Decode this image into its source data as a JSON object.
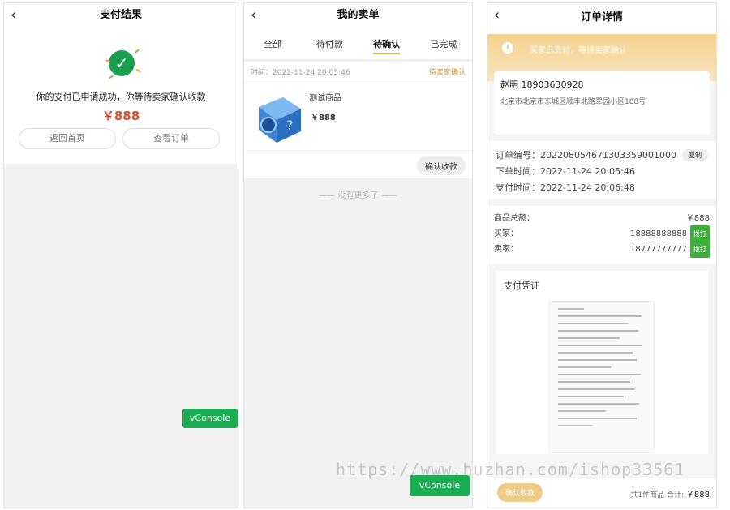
{
  "colors": {
    "accent_red": "#e0482e",
    "gold": "#e8b548",
    "green": "#1aad52"
  },
  "panel1": {
    "title": "支付结果",
    "back_icon": "‹",
    "message": "你的支付已申请成功，你等待卖家确认收款",
    "amount": "￥888",
    "btn_home": "返回首页",
    "btn_order": "查看订单",
    "vconsole": "vConsole"
  },
  "panel2": {
    "title": "我的卖单",
    "back_icon": "‹",
    "tabs": [
      "全部",
      "待付款",
      "待确认",
      "已完成"
    ],
    "order": {
      "time": "时间：2022-11-24 20:05:46",
      "status": "待卖家确认",
      "product_name": "测试商品",
      "price": "￥888",
      "confirm_btn": "确认收款"
    },
    "no_more": "—— 没有更多了 ——",
    "vconsole": "vConsole"
  },
  "panel3": {
    "title": "订单详情",
    "back_icon": "‹",
    "banner_text": "买家已支付，等待卖家确认",
    "addr_name": "赵明   18903630928",
    "addr_line": "北京市北京市东城区顺丰北路翠园小区188号",
    "order_no": "订单编号：2022080546713033590010​00",
    "order_time": "下单时间：2022-11-24 20:05:46",
    "pay_time": "支付时间：2022-11-24 20:06:48",
    "copy_btn": "复制",
    "goods_total_label": "商品总额：",
    "goods_total": "￥888",
    "buyer_label": "买家：",
    "buyer_phone": "18888888888",
    "seller_label": "卖家：",
    "seller_phone": "18777777777",
    "call_btn": "拨打",
    "voucher_title": "支付凭证",
    "confirm_btn": "确认收款",
    "total_label": "共1件商品 合计:",
    "total_amount": "￥888"
  },
  "watermark": "https://www.huzhan.com/ishop33561"
}
